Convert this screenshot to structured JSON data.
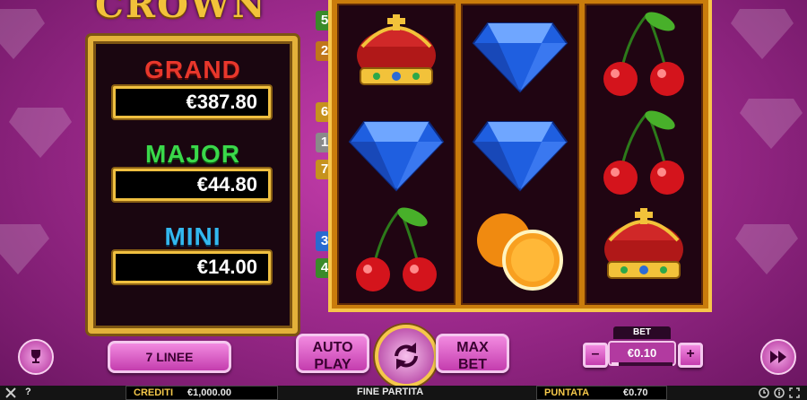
{
  "logo": "CROWN",
  "jackpots": [
    {
      "label": "GRAND",
      "value": "€387.80",
      "color": "#e8372c"
    },
    {
      "label": "MAJOR",
      "value": "€44.80",
      "color": "#3ad84a"
    },
    {
      "label": "MINI",
      "value": "€14.00",
      "color": "#33b8ef"
    }
  ],
  "paylines_left": [
    "5",
    "2",
    "6",
    "1",
    "7",
    "3",
    "4"
  ],
  "reels": [
    [
      "crown",
      "diamond",
      "cherries"
    ],
    [
      "diamond",
      "diamond",
      "orange"
    ],
    [
      "cherries",
      "cherries",
      "crown"
    ]
  ],
  "controls": {
    "lines_label": "7 LINEE",
    "autoplay_line1": "AUTO",
    "autoplay_line2": "PLAY",
    "maxbet_line1": "MAX",
    "maxbet_line2": "BET",
    "bet_label": "BET",
    "bet_value": "€0.10",
    "minus": "–",
    "plus": "+"
  },
  "status": {
    "credits_label": "CREDITI",
    "credits_value": "€1,000.00",
    "center_text": "FINE PARTITA",
    "bet_label": "PUNTATA",
    "bet_value": "€0.70",
    "help": "?"
  },
  "icons": {
    "trophy": "trophy-icon",
    "spin": "spin-arrows-icon",
    "fast": "fast-forward-icon",
    "tools": "tools-icon",
    "clock": "clock-icon",
    "info": "info-icon",
    "fullscreen": "fullscreen-icon"
  }
}
